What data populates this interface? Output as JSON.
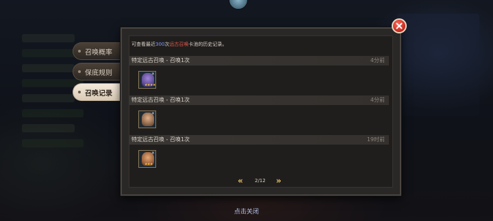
{
  "tabs": [
    {
      "label": "召唤概率",
      "active": false
    },
    {
      "label": "保底规则",
      "active": false
    },
    {
      "label": "召唤记录",
      "active": true
    }
  ],
  "info": {
    "prefix": "可查看最近",
    "count": "300",
    "middle": "次",
    "pool": "远古召唤",
    "suffix": "卡池的历史记录。"
  },
  "records": [
    {
      "title": "特定远古召唤 - 召唤1次",
      "time": "4分前",
      "stars": "★★★★★",
      "hero_color": "#7a5fc0"
    },
    {
      "title": "特定远古召唤 - 召唤1次",
      "time": "4分前",
      "stars": "",
      "hero_color": "#c08850"
    },
    {
      "title": "特定远古召唤 - 召唤1次",
      "time": "19时前",
      "stars": "★★★",
      "hero_color": "#b86a3a"
    }
  ],
  "pager": {
    "prev": "«",
    "next": "»",
    "text": "2/12"
  },
  "close_hint": "点击关闭",
  "colors": {
    "accent_blue": "#7f9cff",
    "accent_red": "#e4574a",
    "gold": "#e9c164"
  }
}
